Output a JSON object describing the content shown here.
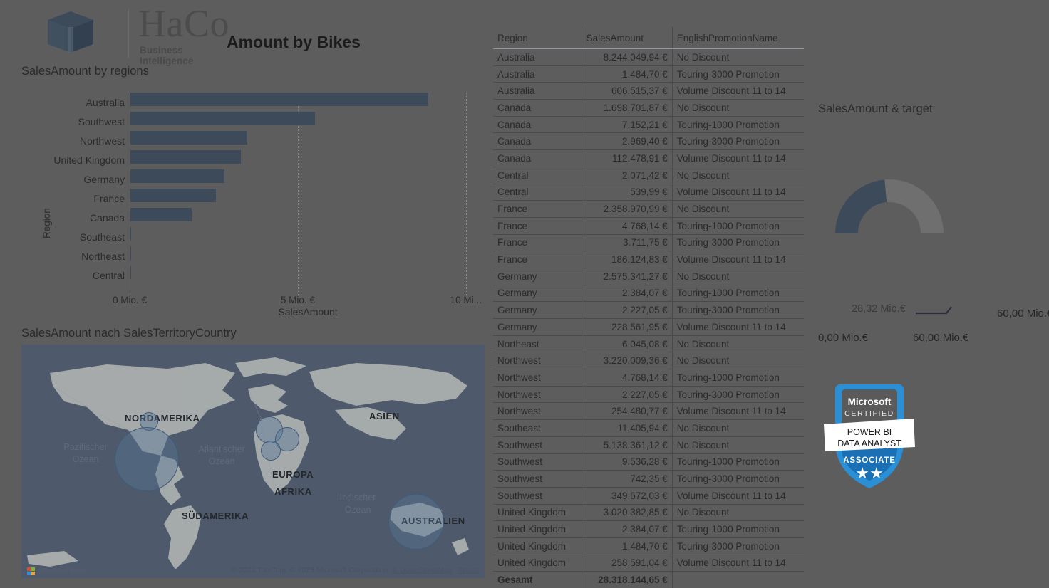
{
  "brand": {
    "name": "HaCo",
    "tagline": "Business Intelligence",
    "logo_icon": "cube-icon",
    "logo_color": "#3c4a5a"
  },
  "report": {
    "title": "Amount by Bikes"
  },
  "bar_panel": {
    "title": "SalesAmount by regions"
  },
  "map_panel": {
    "title": "SalesAmount nach SalesTerritoryCountry",
    "provider_logo": "microsoft-bing-logo",
    "provider_name": "Microsoft Bing",
    "attribution": "© 2022 TomTom, © 2023 Microsoft Corporation,",
    "attribution_link": "© OpenStreetMap",
    "terms_link": "Terms",
    "continents": [
      "NORDAMERIKA",
      "SÜDAMERIKA",
      "EUROPA",
      "AFRIKA",
      "ASIEN",
      "AUSTRALIEN"
    ],
    "oceans": [
      "Pazifischer Ozean",
      "Atlantischer Ozean",
      "Indischer Ozean"
    ]
  },
  "gauge_panel": {
    "title": "SalesAmount & target",
    "value_label": "28,32 Mio.€",
    "min_label": "0,00 Mio.€",
    "max_label": "60,00 Mio.€",
    "target_label": "60,00 Mio.€",
    "fill_color": "#3c4a5a",
    "track_color": "#6f6f6f"
  },
  "badge": {
    "vendor": "Microsoft",
    "certified": "CERTIFIED",
    "track_line1": "POWER BI",
    "track_line2": "DATA ANALYST",
    "level": "ASSOCIATE",
    "stars": "★★",
    "accent_color": "#2b8fd6"
  },
  "chart_data": [
    {
      "type": "bar",
      "orientation": "horizontal",
      "title": "SalesAmount by regions",
      "xlabel": "SalesAmount",
      "ylabel": "Region",
      "categories": [
        "Australia",
        "Southwest",
        "Northwest",
        "United Kingdom",
        "Germany",
        "France",
        "Canada",
        "Southeast",
        "Northeast",
        "Central"
      ],
      "values": [
        8852050,
        5497840,
        3481485,
        3282842,
        2808514,
        2553575,
        1821302,
        11406,
        6045,
        2611
      ],
      "tick_labels": [
        "0 Mio. €",
        "5 Mio. €",
        "10 Mi..."
      ],
      "tick_values": [
        0,
        5000000,
        10000000
      ],
      "xlim": [
        0,
        10600000
      ],
      "grid": true,
      "bar_color": "#3c4a5a"
    },
    {
      "type": "gauge",
      "title": "SalesAmount & target",
      "value": 28.32,
      "min": 0,
      "max": 60,
      "target": 60,
      "unit": "Mio.€",
      "fill_color": "#3c4a5a"
    },
    {
      "type": "table",
      "title": "Region / SalesAmount / EnglishPromotionName",
      "columns": [
        "Region",
        "SalesAmount",
        "EnglishPromotionName"
      ],
      "rows": [
        [
          "Australia",
          "8.244.049,94 €",
          "No Discount"
        ],
        [
          "Australia",
          "1.484,70 €",
          "Touring-3000 Promotion"
        ],
        [
          "Australia",
          "606.515,37 €",
          "Volume Discount 11 to 14"
        ],
        [
          "Canada",
          "1.698.701,87 €",
          "No Discount"
        ],
        [
          "Canada",
          "7.152,21 €",
          "Touring-1000 Promotion"
        ],
        [
          "Canada",
          "2.969,40 €",
          "Touring-3000 Promotion"
        ],
        [
          "Canada",
          "112.478,91 €",
          "Volume Discount 11 to 14"
        ],
        [
          "Central",
          "2.071,42 €",
          "No Discount"
        ],
        [
          "Central",
          "539,99 €",
          "Volume Discount 11 to 14"
        ],
        [
          "France",
          "2.358.970,99 €",
          "No Discount"
        ],
        [
          "France",
          "4.768,14 €",
          "Touring-1000 Promotion"
        ],
        [
          "France",
          "3.711,75 €",
          "Touring-3000 Promotion"
        ],
        [
          "France",
          "186.124,83 €",
          "Volume Discount 11 to 14"
        ],
        [
          "Germany",
          "2.575.341,27 €",
          "No Discount"
        ],
        [
          "Germany",
          "2.384,07 €",
          "Touring-1000 Promotion"
        ],
        [
          "Germany",
          "2.227,05 €",
          "Touring-3000 Promotion"
        ],
        [
          "Germany",
          "228.561,95 €",
          "Volume Discount 11 to 14"
        ],
        [
          "Northeast",
          "6.045,08 €",
          "No Discount"
        ],
        [
          "Northwest",
          "3.220.009,36 €",
          "No Discount"
        ],
        [
          "Northwest",
          "4.768,14 €",
          "Touring-1000 Promotion"
        ],
        [
          "Northwest",
          "2.227,05 €",
          "Touring-3000 Promotion"
        ],
        [
          "Northwest",
          "254.480,77 €",
          "Volume Discount 11 to 14"
        ],
        [
          "Southeast",
          "11.405,94 €",
          "No Discount"
        ],
        [
          "Southwest",
          "5.138.361,12 €",
          "No Discount"
        ],
        [
          "Southwest",
          "9.536,28 €",
          "Touring-1000 Promotion"
        ],
        [
          "Southwest",
          "742,35 €",
          "Touring-3000 Promotion"
        ],
        [
          "Southwest",
          "349.672,03 €",
          "Volume Discount 11 to 14"
        ],
        [
          "United Kingdom",
          "3.020.382,85 €",
          "No Discount"
        ],
        [
          "United Kingdom",
          "2.384,07 €",
          "Touring-1000 Promotion"
        ],
        [
          "United Kingdom",
          "1.484,70 €",
          "Touring-3000 Promotion"
        ],
        [
          "United Kingdom",
          "258.591,04 €",
          "Volume Discount 11 to 14"
        ]
      ],
      "total_label": "Gesamt",
      "total_value": "28.318.144,65 €"
    },
    {
      "type": "scatter",
      "subtype": "bubble-map",
      "title": "SalesAmount nach SalesTerritoryCountry",
      "series": [
        {
          "name": "United States",
          "r": 44
        },
        {
          "name": "Canada",
          "r": 12
        },
        {
          "name": "United Kingdom",
          "r": 18
        },
        {
          "name": "Germany",
          "r": 16
        },
        {
          "name": "France",
          "r": 13
        },
        {
          "name": "Australia",
          "r": 38
        }
      ]
    }
  ]
}
